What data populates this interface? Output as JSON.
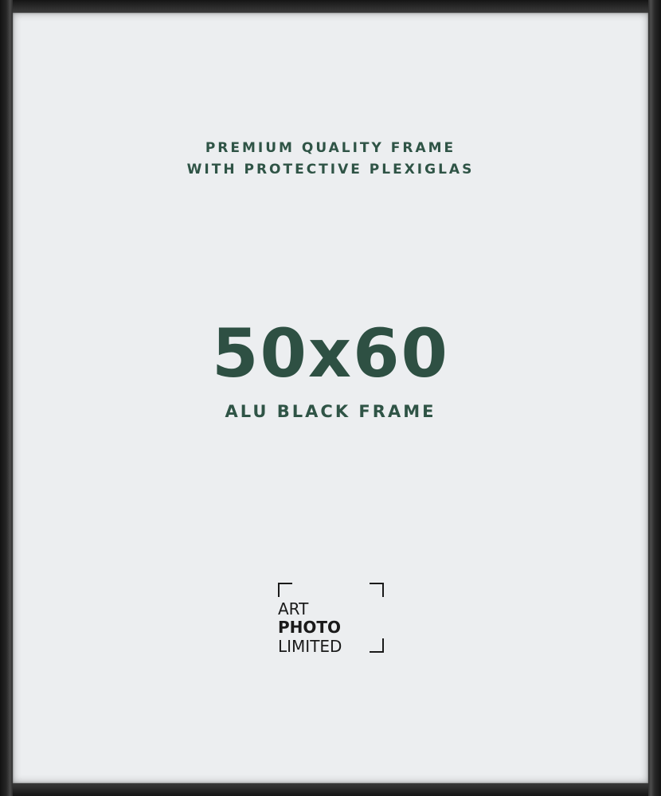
{
  "tagline": {
    "line1": "PREMIUM QUALITY FRAME",
    "line2": "WITH PROTECTIVE PLEXIGLAS"
  },
  "size": "50x60",
  "frame_name": "ALU BLACK FRAME",
  "logo": {
    "line1": "ART",
    "line2": "PHOTO",
    "line3": "LIMITED"
  },
  "colors": {
    "frame": "#222222",
    "mat": "#eceef0",
    "text_green": "#2f5446",
    "logo_black": "#1a1a1a"
  }
}
